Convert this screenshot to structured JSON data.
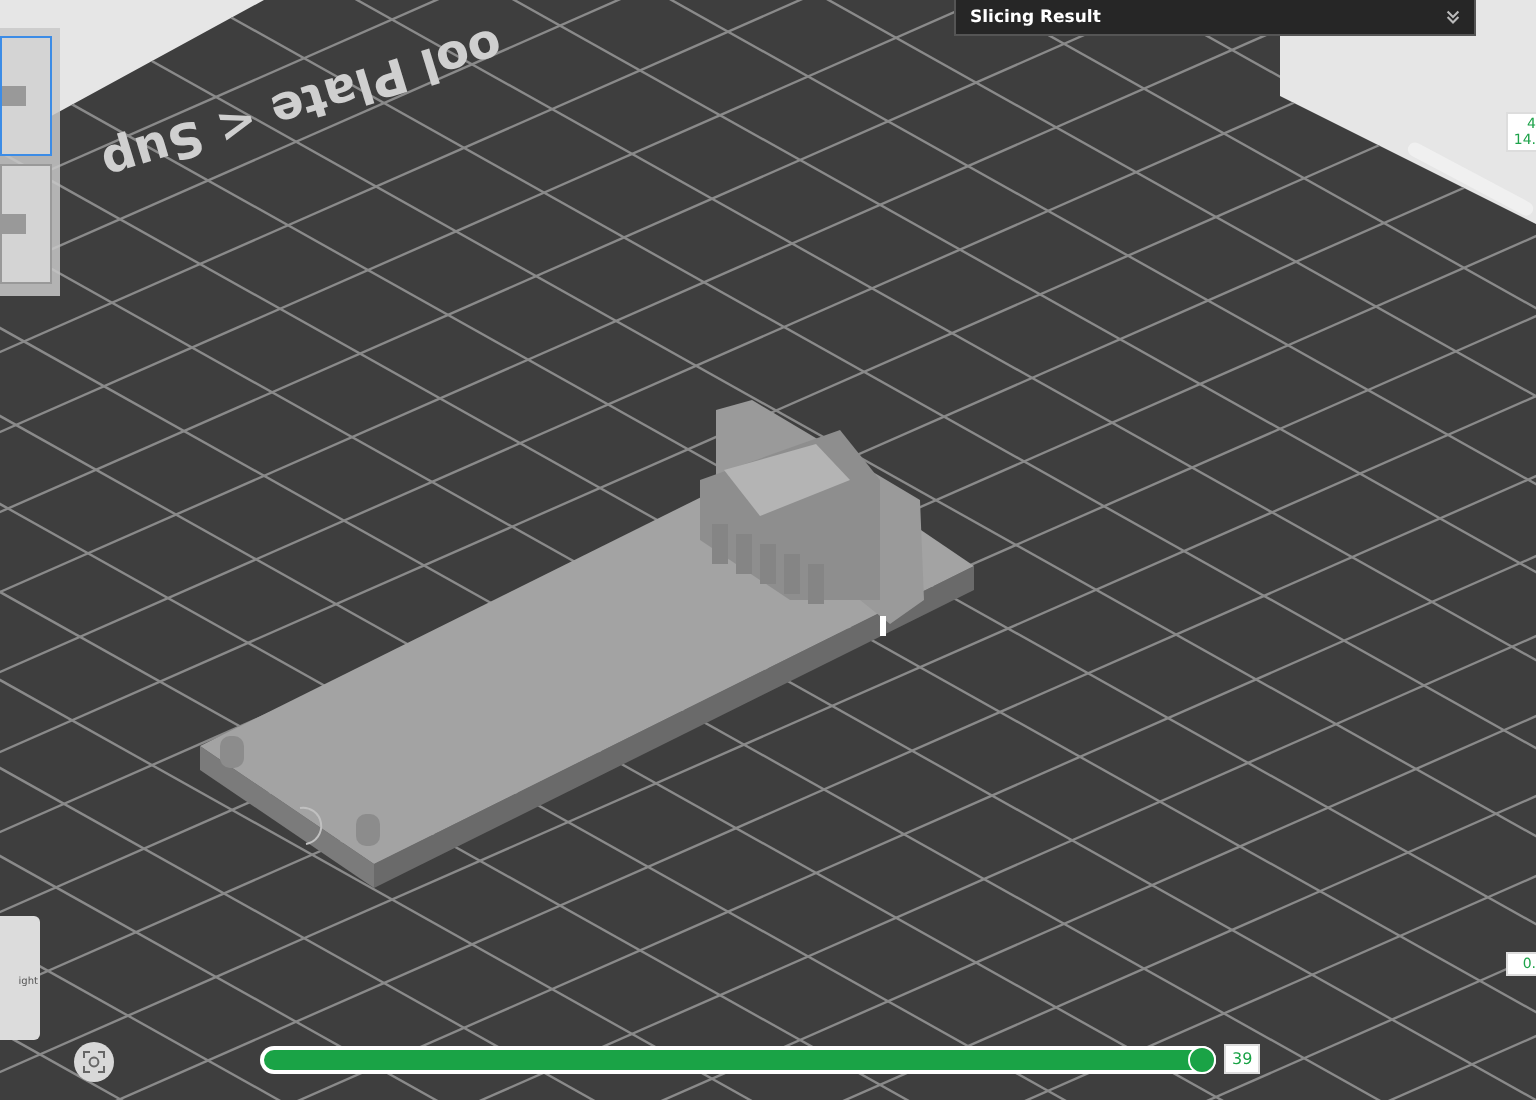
{
  "plate_label": "ool Plate < Sup",
  "slicing_result": {
    "title": "Slicing Result",
    "expanded": false
  },
  "plate_thumbnails": [
    {
      "selected": true
    },
    {
      "selected": false
    }
  ],
  "view_cube": {
    "face_label": "ight"
  },
  "right_labels": [
    {
      "lines": [
        "4",
        "14."
      ]
    },
    {
      "lines": [
        "0."
      ]
    }
  ],
  "layer_slider": {
    "level": 0.99,
    "reading": "39"
  }
}
